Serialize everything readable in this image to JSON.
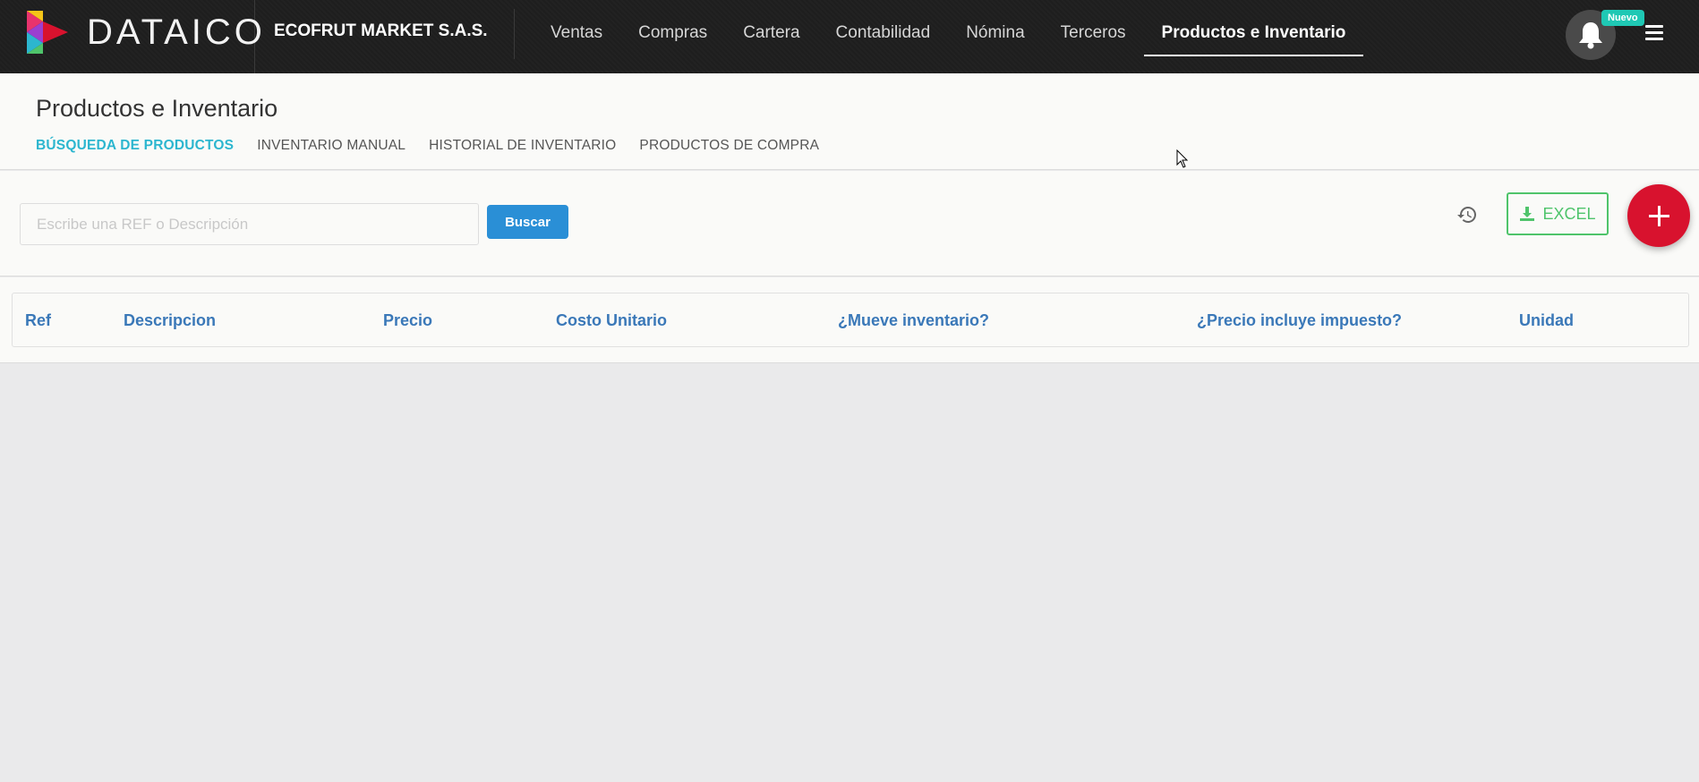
{
  "navbar": {
    "brand": "DATAICO",
    "company": "ECOFRUT MARKET S.A.S.",
    "items": [
      {
        "label": "Ventas"
      },
      {
        "label": "Compras"
      },
      {
        "label": "Cartera"
      },
      {
        "label": "Contabilidad"
      },
      {
        "label": "Nómina"
      },
      {
        "label": "Terceros"
      },
      {
        "label": "Productos e Inventario"
      }
    ],
    "active_index": 6,
    "notification_badge": "Nuevo",
    "icons": [
      "logo-icon",
      "bell-icon",
      "hamburger-menu-icon"
    ]
  },
  "page": {
    "title": "Productos e Inventario",
    "tabs": [
      {
        "label": "BÚSQUEDA DE PRODUCTOS"
      },
      {
        "label": "INVENTARIO MANUAL"
      },
      {
        "label": "HISTORIAL DE INVENTARIO"
      },
      {
        "label": "PRODUCTOS DE COMPRA"
      }
    ],
    "active_tab": 0
  },
  "toolbar": {
    "search": {
      "placeholder": "Escribe una REF o Descripción",
      "value": ""
    },
    "search_button": "Buscar",
    "excel_button": "EXCEL",
    "icons": [
      "history-icon",
      "download-icon",
      "plus-icon"
    ]
  },
  "table": {
    "columns": [
      "Ref",
      "Descripcion",
      "Precio",
      "Costo Unitario",
      "¿Mueve inventario?",
      "¿Precio incluye impuesto?",
      "Unidad"
    ],
    "rows": []
  },
  "colors": {
    "navbar_bg": "#1e1e1e",
    "accent_tab": "#2cb6cf",
    "search_button": "#2a8fd6",
    "excel_green": "#4fc46b",
    "fab_red": "#d8122e",
    "badge_teal": "#1fc8b4",
    "table_header": "#3a78b8"
  }
}
